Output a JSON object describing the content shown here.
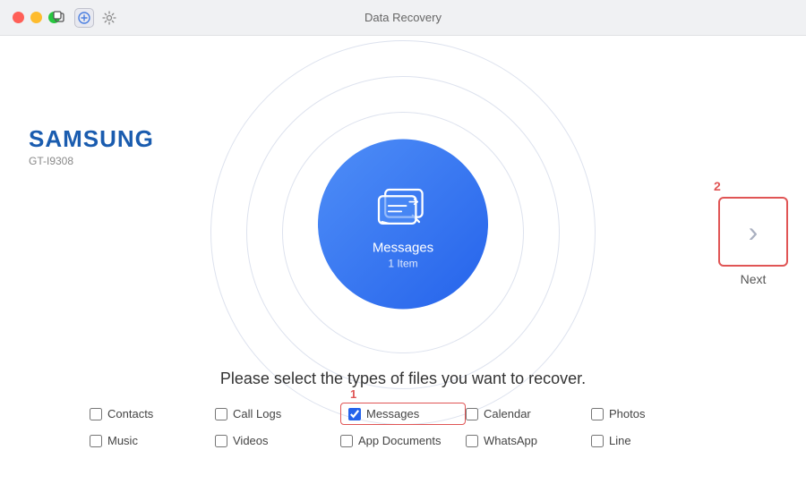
{
  "titleBar": {
    "title": "Data Recovery",
    "buttons": [
      "close",
      "minimize",
      "maximize"
    ]
  },
  "device": {
    "brand": "SAMSUNG",
    "model": "GT-I9308"
  },
  "centerCircle": {
    "label": "Messages",
    "count": "1 Item"
  },
  "nextButton": {
    "label": "Next",
    "stepNumber": "2"
  },
  "prompt": {
    "text": "Please select the types of files you want to recover."
  },
  "fileTypes": [
    {
      "id": "contacts",
      "label": "Contacts",
      "checked": false
    },
    {
      "id": "call-logs",
      "label": "Call Logs",
      "checked": false
    },
    {
      "id": "messages",
      "label": "Messages",
      "checked": true,
      "highlighted": true
    },
    {
      "id": "calendar",
      "label": "Calendar",
      "checked": false
    },
    {
      "id": "photos",
      "label": "Photos",
      "checked": false
    },
    {
      "id": "music",
      "label": "Music",
      "checked": false
    },
    {
      "id": "videos",
      "label": "Videos",
      "checked": false
    },
    {
      "id": "app-documents",
      "label": "App Documents",
      "checked": false
    },
    {
      "id": "whatsapp",
      "label": "WhatsApp",
      "checked": false
    },
    {
      "id": "line",
      "label": "Line",
      "checked": false
    }
  ],
  "stepNumbers": {
    "checkbox": "1",
    "nextBtn": "2"
  }
}
